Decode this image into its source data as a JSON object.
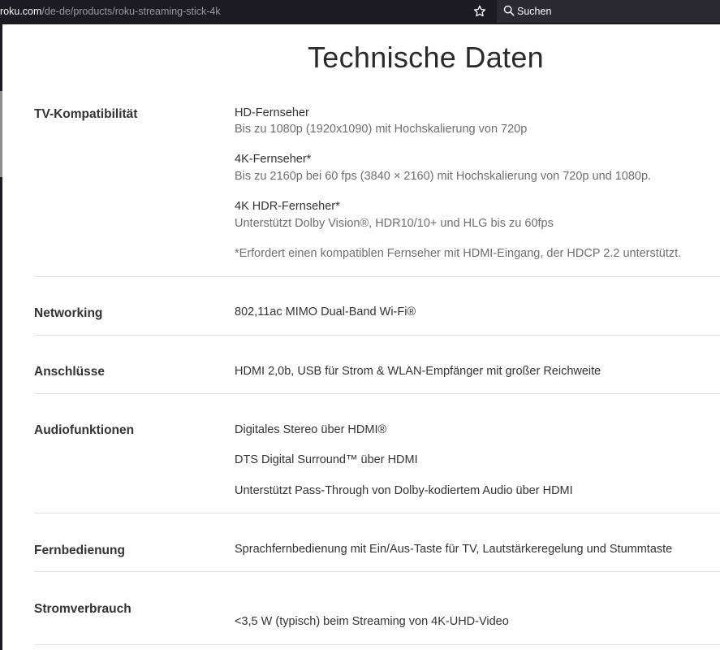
{
  "browser": {
    "url_host": "roku.com",
    "url_path": "/de-de/products/roku-streaming-stick-4k",
    "search_placeholder": "Suchen"
  },
  "page": {
    "title": "Technische Daten"
  },
  "specs": {
    "tv": {
      "label": "TV-Kompatibilität",
      "hd_title": "HD-Fernseher",
      "hd_desc": "Bis zu 1080p (1920x1090) mit Hochskalierung von 720p",
      "k4_title": "4K-Fernseher*",
      "k4_desc": "Bis zu 2160p bei 60 fps (3840 × 2160) mit Hochskalierung von 720p und 1080p.",
      "hdr_title": "4K HDR-Fernseher*",
      "hdr_desc": "Unterstützt Dolby Vision®, HDR10/10+ und HLG bis zu 60fps",
      "note": "*Erfordert einen kompatiblen Fernseher mit HDMI-Eingang, der HDCP 2.2 unterstützt."
    },
    "networking": {
      "label": "Networking",
      "value": "802,11ac MIMO Dual-Band Wi-Fi®"
    },
    "ports": {
      "label": "Anschlüsse",
      "value": "HDMI 2,0b, USB für Strom & WLAN-Empfänger mit großer Reichweite"
    },
    "audio": {
      "label": "Audiofunktionen",
      "line1": "Digitales Stereo über HDMI®",
      "line2": "DTS Digital Surround™ über HDMI",
      "line3": "Unterstützt Pass-Through von Dolby-kodiertem Audio über HDMI"
    },
    "remote": {
      "label": "Fernbedienung",
      "value": "Sprachfernbedienung mit Ein/Aus-Taste für TV, Lautstärkeregelung und Stummtaste"
    },
    "power": {
      "label": "Stromverbrauch",
      "value": "<3,5 W (typisch) beim Streaming von 4K-UHD-Video"
    }
  }
}
